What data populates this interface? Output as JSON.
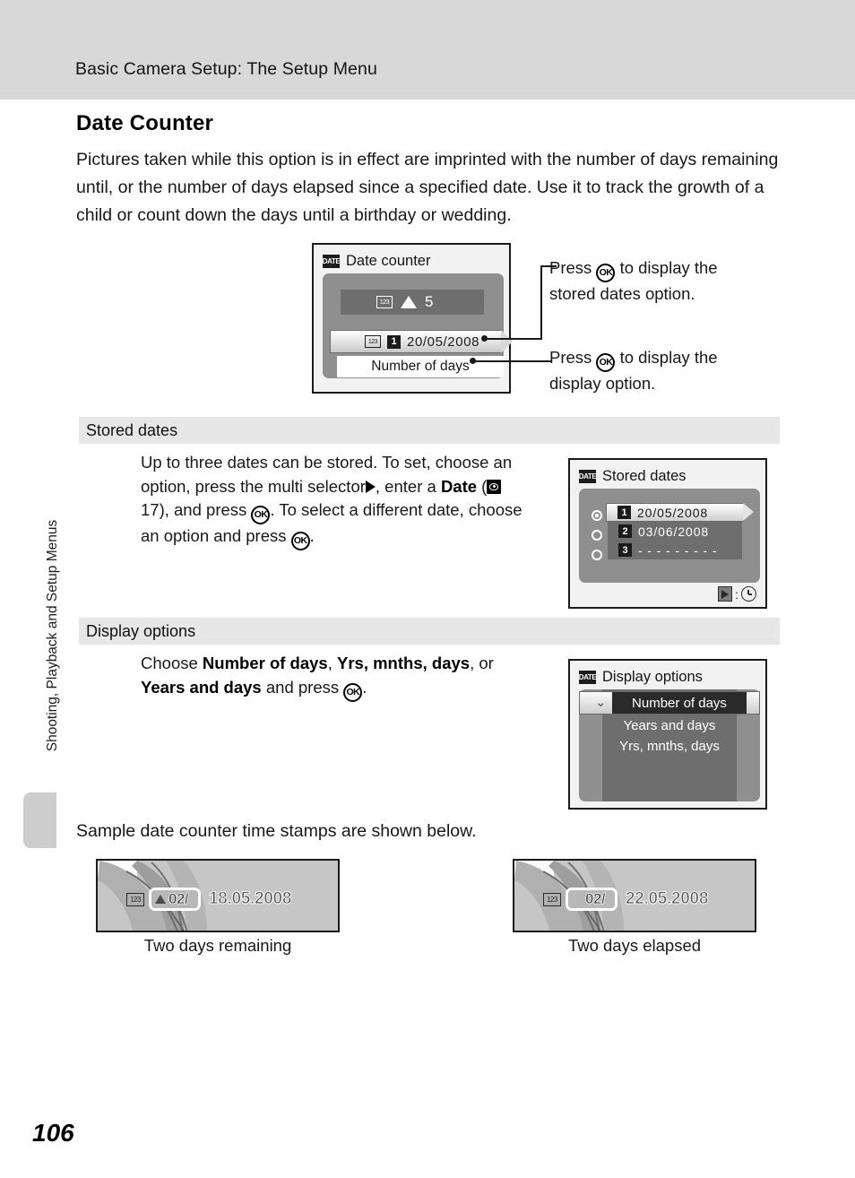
{
  "header": {
    "running_head": "Basic Camera Setup: The Setup Menu"
  },
  "sidebar": {
    "vertical_label": "Shooting, Playback and Setup Menus"
  },
  "page": {
    "number": "106",
    "title": "Date Counter",
    "intro": "Pictures taken while this option is in effect are imprinted with the number of days remaining until, or the number of days elapsed since a specified date. Use it to track the growth of a child or count down the days until a birthday or wedding.",
    "sample_line": "Sample date counter time stamps are shown below."
  },
  "callouts": {
    "first_line1": "Press",
    "first_line2": "to display the",
    "first_line3": "stored dates option.",
    "second_line1": "Press",
    "second_line2": "to display the",
    "second_line3": "display option.",
    "ok_label": "OK"
  },
  "screen_date_counter": {
    "icon": "date-icon",
    "icon_label": "DATE",
    "title": "Date counter",
    "counter_icon_label": "123",
    "direction_icon": "up-triangle-icon",
    "days_value": "5",
    "slot_number": "1",
    "stored_date": "20/05/2008",
    "display_option": "Number of days"
  },
  "section_stored_dates": {
    "heading": "Stored dates",
    "body_part1": "Up to three dates can be stored. To set, choose an option, press the multi selector",
    "body_part2": ", enter a",
    "body_bold_date": "Date",
    "body_part3": "17), and press",
    "body_part4": ". To select a different date, choose an option and press",
    "body_part5": ".",
    "ref_page": "17"
  },
  "screen_stored_dates": {
    "icon_label": "DATE",
    "title": "Stored dates",
    "rows": [
      {
        "selected": true,
        "slot": "1",
        "date": "20/05/2008"
      },
      {
        "selected": false,
        "slot": "2",
        "date": "03/06/2008"
      },
      {
        "selected": false,
        "slot": "3",
        "date": "- - - - - - - - -"
      }
    ],
    "footer_button": "play-icon",
    "footer_separator": ":",
    "footer_icon": "clock-icon"
  },
  "section_display_options": {
    "heading": "Display options",
    "body_part1": "Choose",
    "opt1": "Number of days",
    "sep1": ",",
    "opt2": "Yrs, mnths, days",
    "sep2": ", or",
    "opt3": "Years and days",
    "body_part2": "and press",
    "body_part3": "."
  },
  "screen_display_options": {
    "icon_label": "DATE",
    "title": "Display options",
    "items": [
      {
        "label": "Number of days",
        "selected": true
      },
      {
        "label": "Years and days",
        "selected": false
      },
      {
        "label": "Yrs, mnths, days",
        "selected": false
      }
    ]
  },
  "samples": [
    {
      "marker": "up-triangle-icon",
      "count": "02/",
      "date": "18.05.2008",
      "caption": "Two days remaining",
      "counter_icon_label": "123"
    },
    {
      "marker": "none",
      "count": "02/",
      "date": "22.05.2008",
      "caption": "Two days elapsed",
      "counter_icon_label": "123"
    }
  ],
  "colors": {
    "header_band": "#d8d8d8",
    "section_bar": "#e7e7e7",
    "lcd_panel": "#8f8f8f",
    "lcd_list": "#6e6e6e"
  }
}
